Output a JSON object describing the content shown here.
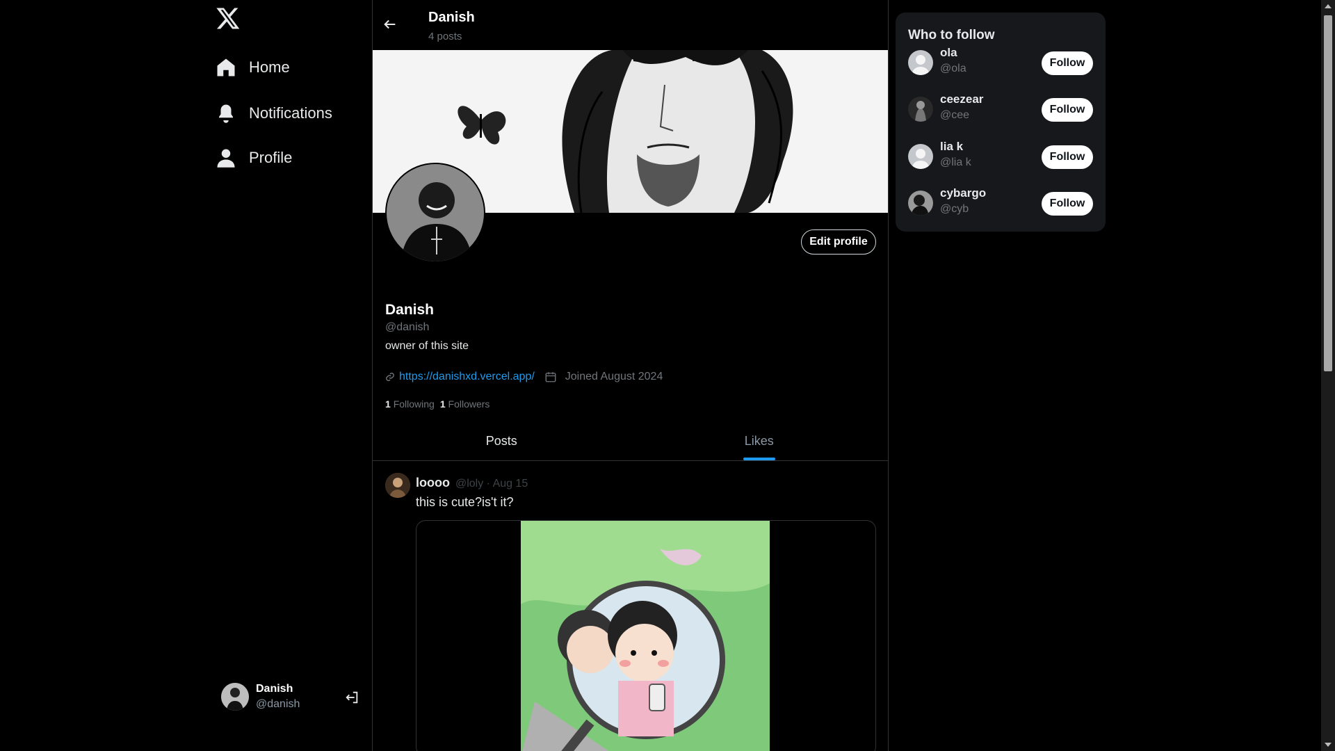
{
  "nav": {
    "items": [
      {
        "label": "Home",
        "icon": "home-icon"
      },
      {
        "label": "Notifications",
        "icon": "bell-icon"
      },
      {
        "label": "Profile",
        "icon": "person-icon"
      }
    ],
    "account": {
      "name": "Danish",
      "handle": "@danish"
    }
  },
  "header": {
    "title": "Danish",
    "subtitle": "4 posts"
  },
  "profile": {
    "name": "Danish",
    "handle": "@danish",
    "bio": "owner of this site",
    "website": "https://danishxd.vercel.app/",
    "joined": "Joined August 2024",
    "following_count": "1",
    "following_label": "Following",
    "followers_count": "1",
    "followers_label": "Followers",
    "edit_label": "Edit profile"
  },
  "tabs": [
    {
      "label": "Posts",
      "active": false
    },
    {
      "label": "Likes",
      "active": true
    }
  ],
  "post": {
    "author": "loooo",
    "handle_date": "@loly · Aug 15",
    "text": "this is cute?is't it?"
  },
  "who_to_follow": {
    "title": "Who to follow",
    "users": [
      {
        "name": "ola",
        "handle": "@ola",
        "button": "Follow"
      },
      {
        "name": "ceezear",
        "handle": "@cee",
        "button": "Follow"
      },
      {
        "name": "lia k",
        "handle": "@lia k",
        "button": "Follow"
      },
      {
        "name": "cybargo",
        "handle": "@cyb",
        "button": "Follow"
      }
    ]
  },
  "colors": {
    "accent": "#1d9bf0",
    "background": "#000000",
    "panel": "#16181c"
  }
}
